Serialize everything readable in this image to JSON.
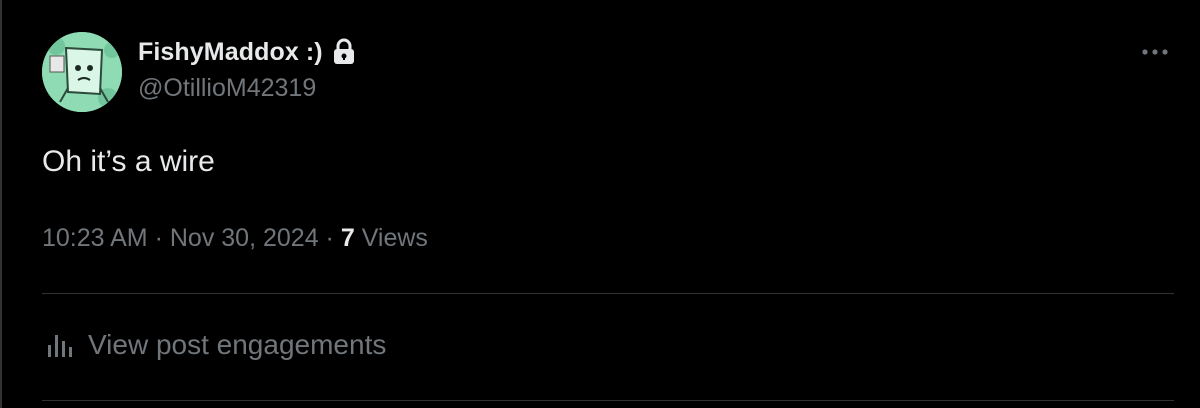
{
  "user": {
    "display_name": "FishyMaddox :)",
    "handle": "@OtillioM42319"
  },
  "post": {
    "text": "Oh it’s a wire",
    "time": "10:23 AM",
    "separator": "·",
    "date": "Nov 30, 2024",
    "views_count": "7",
    "views_label": "Views"
  },
  "actions": {
    "engagements_label": "View post engagements"
  },
  "icons": {
    "lock": "lock-icon",
    "more": "more-icon",
    "engagements": "bar-chart-icon"
  },
  "colors": {
    "background": "#000000",
    "primary_text": "#e7e9ea",
    "secondary_text": "#71767b",
    "divider": "#2f3336",
    "avatar": "#7fd0a8"
  }
}
